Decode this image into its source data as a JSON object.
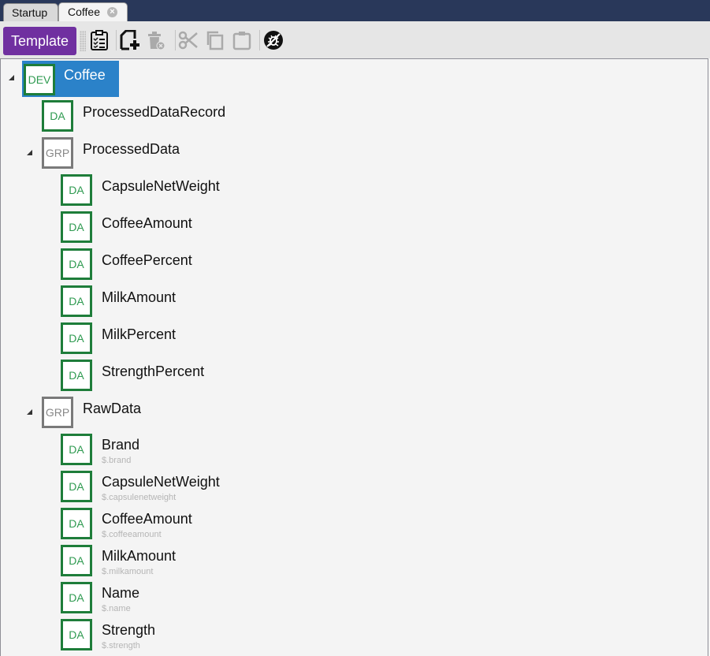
{
  "tabs": [
    {
      "label": "Startup",
      "active": false
    },
    {
      "label": "Coffee",
      "active": true,
      "close_icon": "close-circle-icon"
    }
  ],
  "toolbar": {
    "template_label": "Template",
    "icons": [
      "checklist-icon",
      "add-document-icon",
      "delete-icon",
      "cut-icon",
      "copy-icon",
      "paste-icon",
      "debug-off-icon"
    ],
    "brand_color": "#7030a0"
  },
  "tree": {
    "root": {
      "badge": "DEV",
      "label": "Coffee",
      "selected": true
    },
    "items": [
      {
        "badge": "DA",
        "label": "ProcessedDataRecord",
        "sub": ""
      },
      {
        "badge": "GRP",
        "label": "ProcessedData",
        "expanded": true,
        "children": [
          {
            "badge": "DA",
            "label": "CapsuleNetWeight"
          },
          {
            "badge": "DA",
            "label": "CoffeeAmount"
          },
          {
            "badge": "DA",
            "label": "CoffeePercent"
          },
          {
            "badge": "DA",
            "label": "MilkAmount"
          },
          {
            "badge": "DA",
            "label": "MilkPercent"
          },
          {
            "badge": "DA",
            "label": "StrengthPercent"
          }
        ]
      },
      {
        "badge": "GRP",
        "label": "RawData",
        "expanded": true,
        "children": [
          {
            "badge": "DA",
            "label": "Brand",
            "sub": "$.brand"
          },
          {
            "badge": "DA",
            "label": "CapsuleNetWeight",
            "sub": "$.capsulenetweight"
          },
          {
            "badge": "DA",
            "label": "CoffeeAmount",
            "sub": "$.coffeeamount"
          },
          {
            "badge": "DA",
            "label": "MilkAmount",
            "sub": "$.milkamount"
          },
          {
            "badge": "DA",
            "label": "Name",
            "sub": "$.name"
          },
          {
            "badge": "DA",
            "label": "Strength",
            "sub": "$.strength"
          }
        ]
      }
    ],
    "colors": {
      "selection": "#2b82c9",
      "da_border": "#1e7d3a",
      "grp_border": "#7a7a7a"
    }
  }
}
